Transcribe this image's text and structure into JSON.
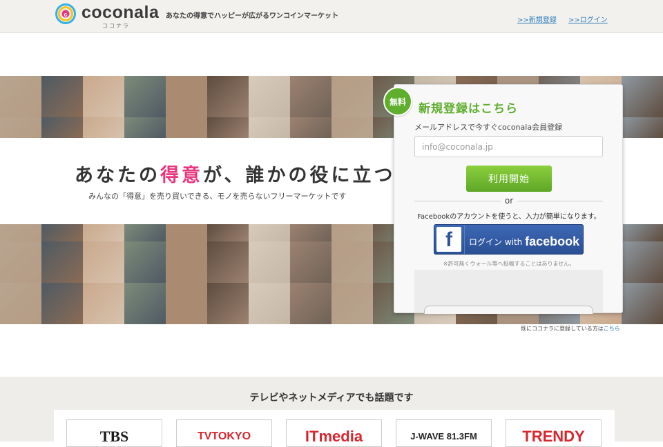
{
  "header": {
    "logo_text": "coconala",
    "logo_kana": "ココナラ",
    "tagline": "あなたの得意でハッピーが広がるワンコインマーケット",
    "signup_link": ">>新規登録",
    "login_link": ">>ログイン"
  },
  "hero": {
    "title_pre": "あなたの",
    "title_highlight": "得意",
    "title_post": "が、誰かの役に立つ",
    "subtitle": "みんなの「得意」を売り買いできる、モノを売らないフリーマーケットです"
  },
  "register": {
    "badge": "無料",
    "title": "新規登録はこちら",
    "email_label": "メールアドレスで今すぐcoconala会員登録",
    "email_placeholder": "info@coconala.jp",
    "submit_label": "利用開始",
    "or_text": "or",
    "facebook_note": "Facebookのアカウントを使うと、入力が簡単になります。",
    "facebook_button_prefix": "ログイン with",
    "facebook_button_brand": "facebook",
    "facebook_warning": "※許可無くウォール等へ投稿することはありません。"
  },
  "already": {
    "text": "既にココナラに登録している方は",
    "link": "こちら"
  },
  "media": {
    "title": "テレビやネットメディアでも話題です",
    "logos": [
      {
        "name": "TBS",
        "color": "#1a1a1a"
      },
      {
        "name": "TVTOKYO",
        "color": "#d8262d"
      },
      {
        "name": "ITmedia",
        "color": "#d8262d"
      },
      {
        "name": "J-WAVE 81.3FM",
        "color": "#222222"
      },
      {
        "name": "TRENDY",
        "color": "#d8262d"
      }
    ]
  },
  "colors": {
    "brand_green": "#5fae2e",
    "highlight_pink": "#e8357e",
    "link_blue": "#2a7ab8",
    "facebook_blue": "#2d539b"
  }
}
